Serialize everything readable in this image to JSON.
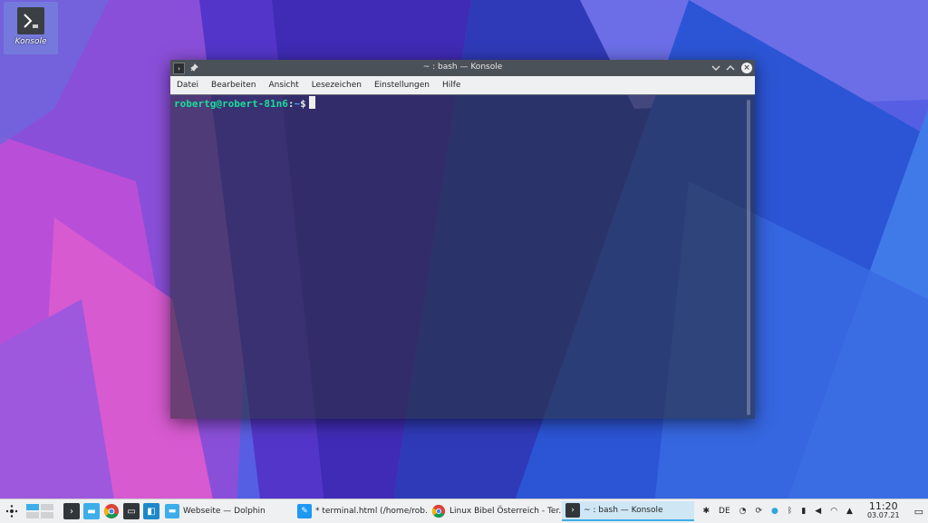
{
  "desktop": {
    "icon_label": "Konsole"
  },
  "window": {
    "title": "~ : bash — Konsole",
    "menu": [
      "Datei",
      "Bearbeiten",
      "Ansicht",
      "Lesezeichen",
      "Einstellungen",
      "Hilfe"
    ],
    "prompt": {
      "user": "robertg@robert-81n6",
      "colon": ":",
      "path": "~",
      "dollar": "$"
    }
  },
  "taskbar": {
    "tasks": [
      {
        "label": "Webseite — Dolphin",
        "icon": "folder-icon"
      },
      {
        "label": "* terminal.html (/home/rob...",
        "icon": "kate-icon"
      },
      {
        "label": "Linux Bibel Österreich - Ter...",
        "icon": "chrome-icon"
      },
      {
        "label": "~ : bash — Konsole",
        "icon": "konsole-icon"
      }
    ],
    "keyboard_layout": "DE",
    "clock": {
      "time": "11:20",
      "date": "03.07.21"
    }
  },
  "colors": {
    "accent": "#3daee9",
    "prompt_user": "#1cdc9a",
    "titlebar": "#4a5158",
    "taskbar": "#eff0f1"
  }
}
